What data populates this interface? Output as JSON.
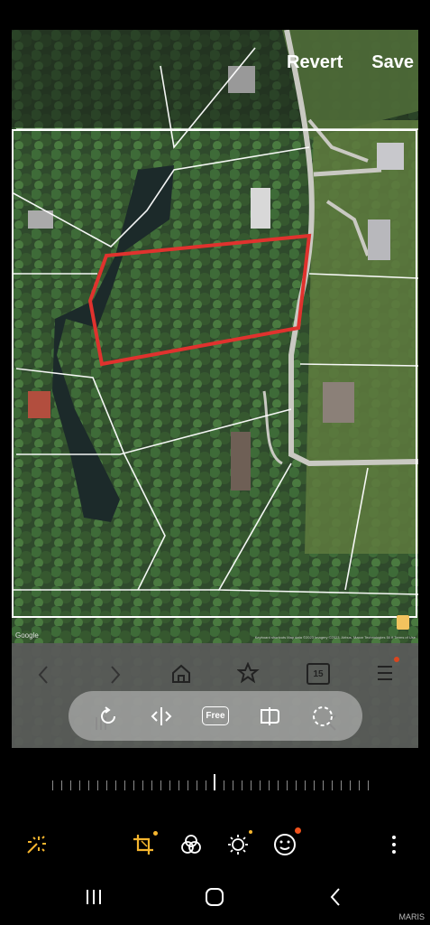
{
  "header": {
    "revert_label": "Revert",
    "save_label": "Save"
  },
  "photo": {
    "map_credit": "Google",
    "map_attribution": "Keyboard shortcuts   Map data ©2023 Imagery ©2023, Airbus, Maxar Technologies   50 ft   Terms of Use",
    "inner_tab_count": "15"
  },
  "crop_tools": {
    "items": [
      {
        "name": "rotate",
        "icon": "rotate-icon"
      },
      {
        "name": "flip",
        "icon": "flip-horizontal-icon"
      },
      {
        "name": "aspect_ratio",
        "label": "Free"
      },
      {
        "name": "perspective",
        "icon": "perspective-icon"
      },
      {
        "name": "lasso",
        "icon": "lasso-icon"
      }
    ]
  },
  "toolbar": {
    "items": [
      "auto-enhance-icon",
      "crop-icon",
      "filters-icon",
      "brightness-icon",
      "sticker-icon",
      "more-options-icon"
    ],
    "accent": "#f5b52e",
    "notification": "#f0521c"
  },
  "watermark": "MARIS"
}
